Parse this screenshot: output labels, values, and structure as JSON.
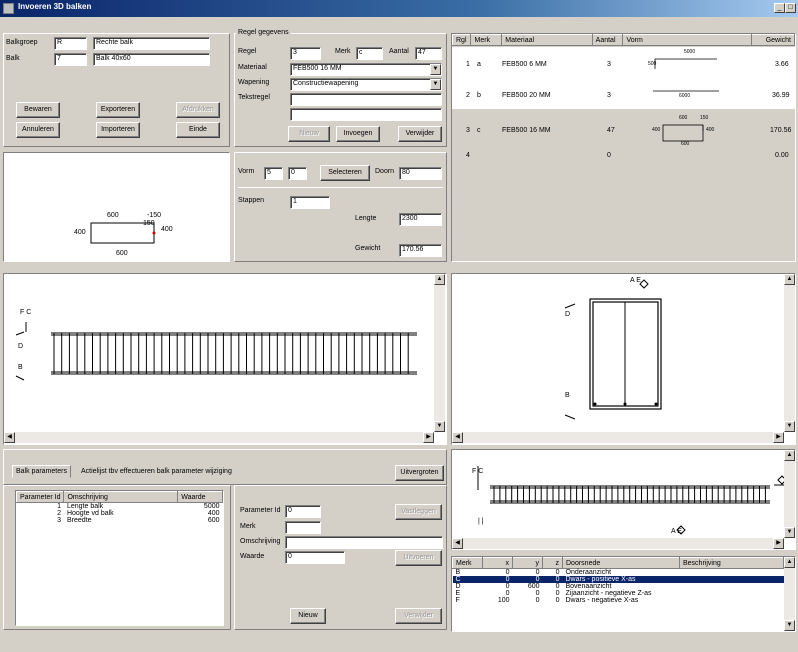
{
  "window": {
    "title": "Invoeren 3D balken",
    "minimize": "_",
    "maximize": "□"
  },
  "header": {
    "balkgroep_label": "Balkgroep",
    "balkgroep_value": "R",
    "balkgroep_name": "Rechte balk",
    "balk_label": "Balk",
    "balk_value": "7",
    "balk_name": "Balk 40x60"
  },
  "actions": {
    "bewaren": "Bewaren",
    "exporteren": "Exporteren",
    "afdrukken": "Afdrukken",
    "annuleren": "Annuleren",
    "importeren": "Importeren",
    "einde": "Einde"
  },
  "regel": {
    "group_title": "Regel gegevens",
    "regel_label": "Regel",
    "regel_value": "3",
    "merk_label": "Merk",
    "merk_value": "c",
    "aantal_label": "Aantal",
    "aantal_value": "47",
    "materiaal_label": "Materiaal",
    "materiaal_value": "FEB500 16 MM",
    "wapening_label": "Wapening",
    "wapening_value": "Constructiewapening",
    "tekstregel_label": "Tekstregel",
    "tekstregel_value": "",
    "tekstregel_value2": "",
    "nieuw": "Nieuw",
    "invoegen": "Invoegen",
    "verwijder": "Verwijder"
  },
  "vorm": {
    "vorm_label": "Vorm",
    "vorm_value": "5",
    "vorm_value2": "0",
    "selecteren": "Selecteren",
    "doorn_label": "Doorn",
    "doorn_value": "80",
    "stappen_label": "Stappen",
    "stappen_value": "1",
    "lengte_label": "Lengte",
    "lengte_value": "2300",
    "gewicht_label": "Gewicht",
    "gewicht_value": "170.56"
  },
  "shape_preview": {
    "top": "600",
    "hook": "150",
    "hook2": "-150",
    "left": "400",
    "right": "400",
    "bottom": "600"
  },
  "rows_table": {
    "headers": [
      "Rgl",
      "Merk",
      "Materiaal",
      "Aantal",
      "Vorm",
      "Gewicht"
    ],
    "rows": [
      {
        "rgl": "1",
        "merk": "a",
        "materiaal": "FEB500 6 MM",
        "aantal": "3",
        "gewicht": "3.66",
        "shape_a": "5000",
        "shape_b": "500"
      },
      {
        "rgl": "2",
        "merk": "b",
        "materiaal": "FEB500 20 MM",
        "aantal": "3",
        "gewicht": "36.99",
        "shape_a": "6000"
      },
      {
        "rgl": "3",
        "merk": "c",
        "materiaal": "FEB500 16 MM",
        "aantal": "47",
        "gewicht": "170.56",
        "shape_a": "600",
        "shape_b": "150",
        "shape_c": "400",
        "shape_d": "400",
        "shape_e": "600"
      },
      {
        "rgl": "4",
        "merk": "",
        "materiaal": "",
        "aantal": "0",
        "gewicht": "0.00"
      }
    ]
  },
  "views": {
    "side_labels": {
      "fc": "F  C",
      "d": "D",
      "b": "B"
    },
    "section_labels": {
      "ae": "A  E",
      "d": "D",
      "b": "B"
    },
    "top_labels": {
      "fc": "F  C",
      "e": "E",
      "a": "A",
      "ae": "A  E",
      "ii": "| |"
    }
  },
  "params": {
    "tab_balk": "Balk parameters",
    "tab_hint": "Actielijst tbv effectueren balk parameter wijziging",
    "uitvergroten": "Uitvergroten",
    "headers": [
      "Parameter Id",
      "Omschrijving",
      "Waarde"
    ],
    "rows": [
      {
        "id": "1",
        "omschrijving": "Lengte balk",
        "waarde": "5000"
      },
      {
        "id": "2",
        "omschrijving": "Hoogte vd balk",
        "waarde": "400"
      },
      {
        "id": "3",
        "omschrijving": "Breedte",
        "waarde": "600"
      }
    ]
  },
  "param_edit": {
    "id_label": "Parameter Id",
    "id_value": "0",
    "merk_label": "Merk",
    "merk_value": "",
    "omschrijving_label": "Omschrijving",
    "omschrijving_value": "",
    "waarde_label": "Waarde",
    "waarde_value": "0",
    "vastleggen": "Vastleggen",
    "uitvoeren": "Uitvoeren",
    "nieuw": "Nieuw",
    "verwijder": "Verwijder"
  },
  "views_table": {
    "headers": [
      "Merk",
      "x",
      "y",
      "z",
      "Doorsnede",
      "Beschrijving"
    ],
    "rows": [
      {
        "merk": "B",
        "x": "0",
        "y": "0",
        "z": "0",
        "doorsnede": "Onderaanzicht",
        "beschrijving": ""
      },
      {
        "merk": "C",
        "x": "0",
        "y": "0",
        "z": "0",
        "doorsnede": "Dwars - positieve X-as",
        "beschrijving": ""
      },
      {
        "merk": "D",
        "x": "0",
        "y": "600",
        "z": "0",
        "doorsnede": "Bovenaanzicht",
        "beschrijving": ""
      },
      {
        "merk": "E",
        "x": "0",
        "y": "0",
        "z": "0",
        "doorsnede": "Zijaanzicht - negatieve Z-as",
        "beschrijving": ""
      },
      {
        "merk": "F",
        "x": "100",
        "y": "0",
        "z": "0",
        "doorsnede": "Dwars - negatieve X-as",
        "beschrijving": ""
      }
    ]
  }
}
